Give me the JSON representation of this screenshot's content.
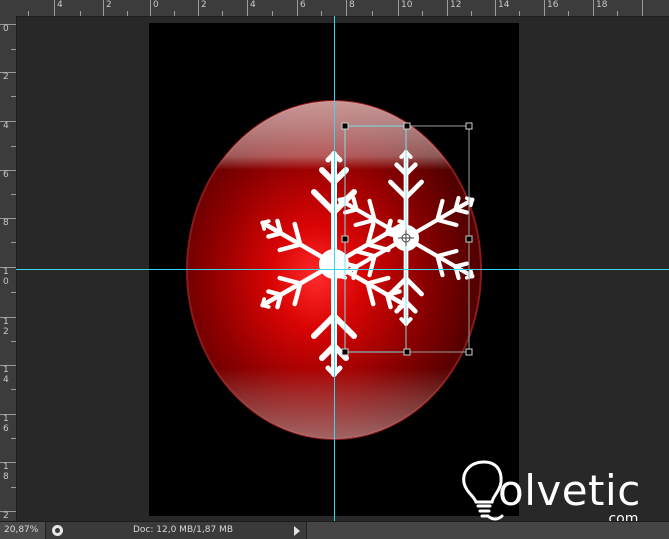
{
  "ruler": {
    "top_labels": [
      "4",
      "2",
      "0",
      "2",
      "4",
      "6",
      "8",
      "10",
      "12",
      "14",
      "16",
      "18"
    ],
    "left_labels": [
      "0",
      "2",
      "4",
      "6",
      "8",
      "1",
      "0",
      "1",
      "2",
      "1",
      "4",
      "1",
      "6",
      "1",
      "8",
      "2"
    ]
  },
  "status": {
    "zoom": "20,87%",
    "doc": "Doc: 12,0 MB/1,87 MB"
  },
  "watermark": {
    "brand": "olvetic",
    "suffix": ".com"
  },
  "colors": {
    "guide": "#38d8e8",
    "ball": "#cc0000",
    "canvas": "#000000",
    "workspace": "#282828"
  },
  "icons": {
    "status_menu": "circle-icon",
    "status_expand": "triangle-right-icon",
    "transform_center": "crosshair-icon"
  }
}
